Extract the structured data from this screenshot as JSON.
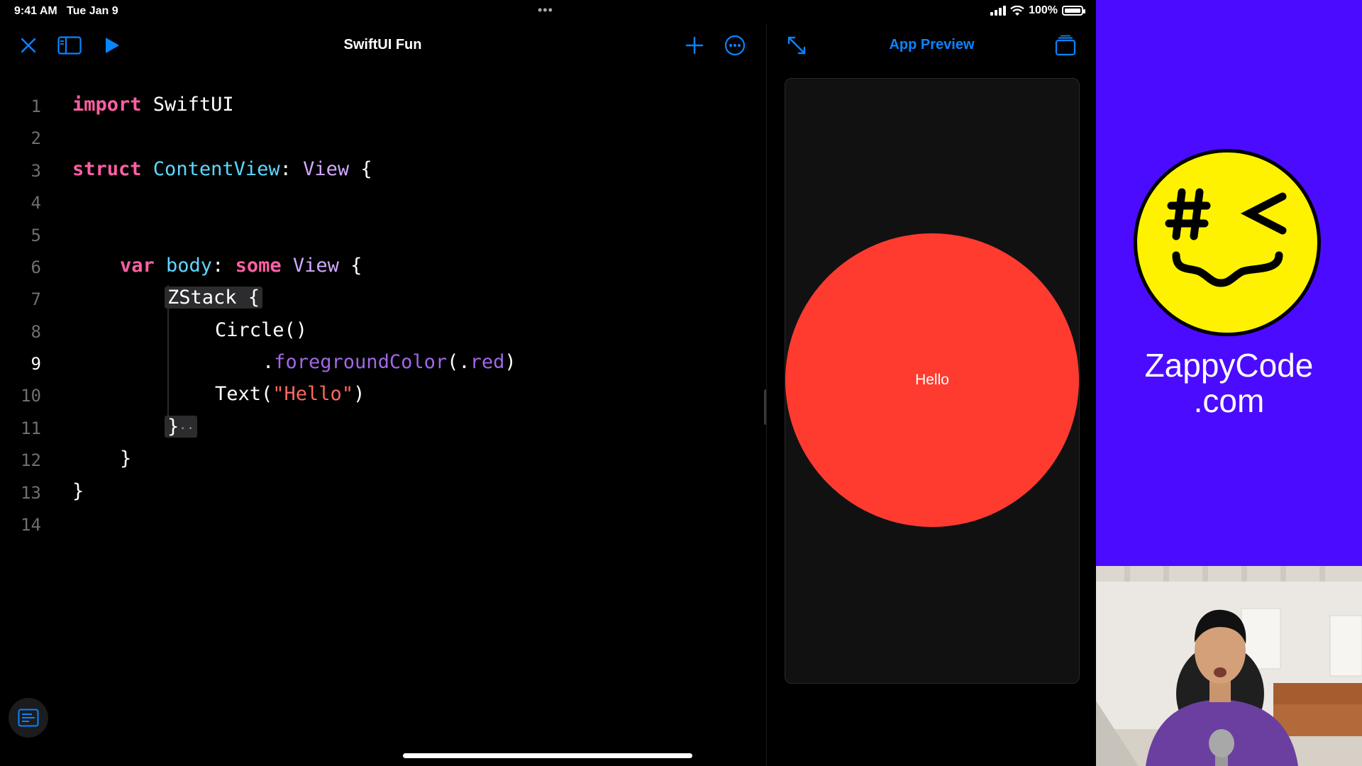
{
  "status_bar": {
    "time": "9:41 AM",
    "date": "Tue Jan 9",
    "battery": "100%"
  },
  "editor": {
    "title": "SwiftUI Fun",
    "lines": [
      {
        "num": "1"
      },
      {
        "num": "2"
      },
      {
        "num": "3"
      },
      {
        "num": "4"
      },
      {
        "num": "5"
      },
      {
        "num": "6"
      },
      {
        "num": "7"
      },
      {
        "num": "8"
      },
      {
        "num": "9"
      },
      {
        "num": "10"
      },
      {
        "num": "11"
      },
      {
        "num": "12"
      },
      {
        "num": "13"
      },
      {
        "num": "14"
      }
    ],
    "current_line": "9",
    "code": {
      "l1_kw": "import",
      "l1_rest": " SwiftUI",
      "l3_kw": "struct",
      "l3_type": " ContentView",
      "l3_colon": ": ",
      "l3_proto": "View",
      "l3_brace": " {",
      "l6_kw": "var",
      "l6_name": " body",
      "l6_colon": ": ",
      "l6_kw2": "some",
      "l6_type": " View",
      "l6_brace": " {",
      "l7": "ZStack {",
      "l8": "Circle()",
      "l9_dot": ".",
      "l9_method": "foregroundColor",
      "l9_paren": "(.",
      "l9_arg": "red",
      "l9_close": ")",
      "l10_fn": "Text(",
      "l10_str": "\"Hello\"",
      "l10_close": ")",
      "l11": "}",
      "l11_fold": "··",
      "l12": "}",
      "l13": "}"
    },
    "icons": [
      "close-icon",
      "sidebar-icon",
      "play-icon",
      "plus-icon",
      "more-icon",
      "notes-icon"
    ]
  },
  "preview": {
    "title": "App Preview",
    "circle_text": "Hello",
    "circle_color": "#ff3b30",
    "icons": [
      "expand-icon",
      "stack-icon"
    ]
  },
  "promo": {
    "brand_line1": "ZappyCode",
    "brand_line2": ".com",
    "background": "#4b0bff"
  }
}
